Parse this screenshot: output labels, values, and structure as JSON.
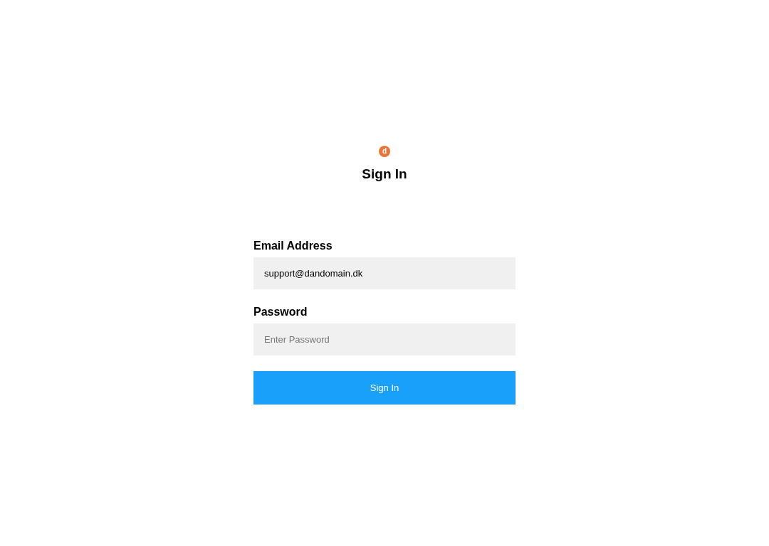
{
  "logo": {
    "letter": "d"
  },
  "title": "Sign In",
  "fields": [
    {
      "label": "Email Address",
      "value": "support@dandomain.dk"
    },
    {
      "label": "Password",
      "placeholder": "Enter Password"
    }
  ],
  "button": "Sign In"
}
